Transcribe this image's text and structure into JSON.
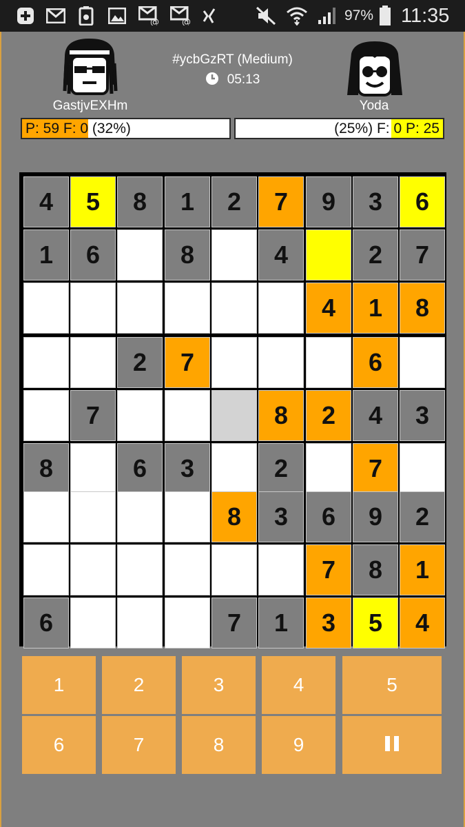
{
  "status_bar": {
    "battery": "97%",
    "time": "11:35"
  },
  "game": {
    "title": "#ycbGzRT (Medium)",
    "time": "05:13"
  },
  "players": {
    "left": {
      "name": "GastjvEXHm",
      "bar_text": "P: 59 F: 0 (32%)",
      "progress": 0.32,
      "color": "#ffa500"
    },
    "right": {
      "name": "Yoda",
      "bar_text": "(25%) F: 0 P: 25",
      "progress": 0.25,
      "color": "#ffff00"
    }
  },
  "colors": {
    "given": "#7f7f7f",
    "empty": "#ffffff",
    "player1": "#ffa500",
    "player2": "#ffff00",
    "selected": "#d3d3d3",
    "key": "#efab4e"
  },
  "board": {
    "values": [
      [
        "4",
        "5",
        "8",
        "1",
        "2",
        "7",
        "9",
        "3",
        "6"
      ],
      [
        "1",
        "6",
        "",
        "8",
        "",
        "4",
        "",
        "2",
        "7"
      ],
      [
        "",
        "",
        "",
        "",
        "",
        "",
        "4",
        "1",
        "8"
      ],
      [
        "",
        "",
        "2",
        "7",
        "",
        "",
        "",
        "6",
        ""
      ],
      [
        "",
        "7",
        "",
        "",
        "",
        "8",
        "2",
        "4",
        "3"
      ],
      [
        "8",
        "",
        "6",
        "3",
        "",
        "2",
        "",
        "7",
        ""
      ],
      [
        "",
        "",
        "",
        "",
        "8",
        "3",
        "6",
        "9",
        "2"
      ],
      [
        "",
        "",
        "",
        "",
        "",
        "",
        "7",
        "8",
        "1"
      ],
      [
        "6",
        "",
        "",
        "",
        "7",
        "1",
        "3",
        "5",
        "4"
      ]
    ],
    "kinds": [
      [
        "g",
        "y",
        "g",
        "g",
        "g",
        "o",
        "g",
        "g",
        "y"
      ],
      [
        "g",
        "g",
        "w",
        "g",
        "w",
        "g",
        "y",
        "g",
        "g"
      ],
      [
        "w",
        "w",
        "w",
        "w",
        "w",
        "w",
        "o",
        "o",
        "o"
      ],
      [
        "w",
        "w",
        "g",
        "o",
        "w",
        "w",
        "w",
        "o",
        "w"
      ],
      [
        "w",
        "g",
        "w",
        "w",
        "s",
        "o",
        "o",
        "g",
        "g"
      ],
      [
        "g",
        "w",
        "g",
        "g",
        "w",
        "g",
        "w",
        "o",
        "w"
      ],
      [
        "w",
        "w",
        "w",
        "w",
        "o",
        "g",
        "g",
        "g",
        "g"
      ],
      [
        "w",
        "w",
        "w",
        "w",
        "w",
        "w",
        "o",
        "g",
        "o"
      ],
      [
        "g",
        "w",
        "w",
        "w",
        "g",
        "g",
        "o",
        "y",
        "o"
      ]
    ]
  },
  "keypad": {
    "keys": [
      "1",
      "2",
      "3",
      "4",
      "5",
      "6",
      "7",
      "8",
      "9"
    ],
    "pause_icon": "pause-icon"
  }
}
